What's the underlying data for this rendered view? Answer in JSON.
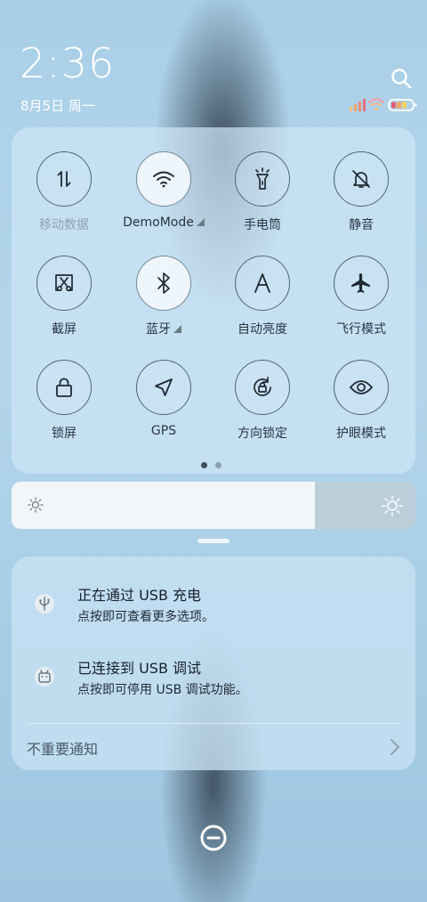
{
  "status_bar": {
    "time": "2:36",
    "date": "8月5日 周一"
  },
  "quick_settings": {
    "tiles": [
      {
        "label": "移动数据",
        "icon": "mobile-data-icon",
        "active": false,
        "dimmed": true
      },
      {
        "label": "DemoMode",
        "icon": "wifi-icon",
        "active": true,
        "expandable": true
      },
      {
        "label": "手电筒",
        "icon": "flashlight-icon",
        "active": false
      },
      {
        "label": "静音",
        "icon": "mute-bell-icon",
        "active": false
      },
      {
        "label": "截屏",
        "icon": "screenshot-icon",
        "active": false
      },
      {
        "label": "蓝牙",
        "icon": "bluetooth-icon",
        "active": true,
        "expandable": true
      },
      {
        "label": "自动亮度",
        "icon": "auto-brightness-icon",
        "active": false
      },
      {
        "label": "飞行模式",
        "icon": "airplane-icon",
        "active": false
      },
      {
        "label": "锁屏",
        "icon": "lock-icon",
        "active": false
      },
      {
        "label": "GPS",
        "icon": "gps-icon",
        "active": false
      },
      {
        "label": "方向锁定",
        "icon": "rotation-lock-icon",
        "active": false
      },
      {
        "label": "护眼模式",
        "icon": "eye-icon",
        "active": false
      }
    ],
    "page_count": 2,
    "current_page": 1
  },
  "brightness": {
    "level": 0.75
  },
  "notifications": {
    "items": [
      {
        "title": "正在通过 USB 充电",
        "subtitle": "点按即可查看更多选项。",
        "icon": "usb-icon"
      },
      {
        "title": "已连接到 USB 调试",
        "subtitle": "点按即可停用 USB 调试功能。",
        "icon": "android-debug-icon"
      }
    ],
    "unimportant_label": "不重要通知"
  },
  "colors": {
    "accent_dark": "#2a3540",
    "dimmed_text": "#8fa2af",
    "tile_active_bg": "#eef5fb"
  }
}
